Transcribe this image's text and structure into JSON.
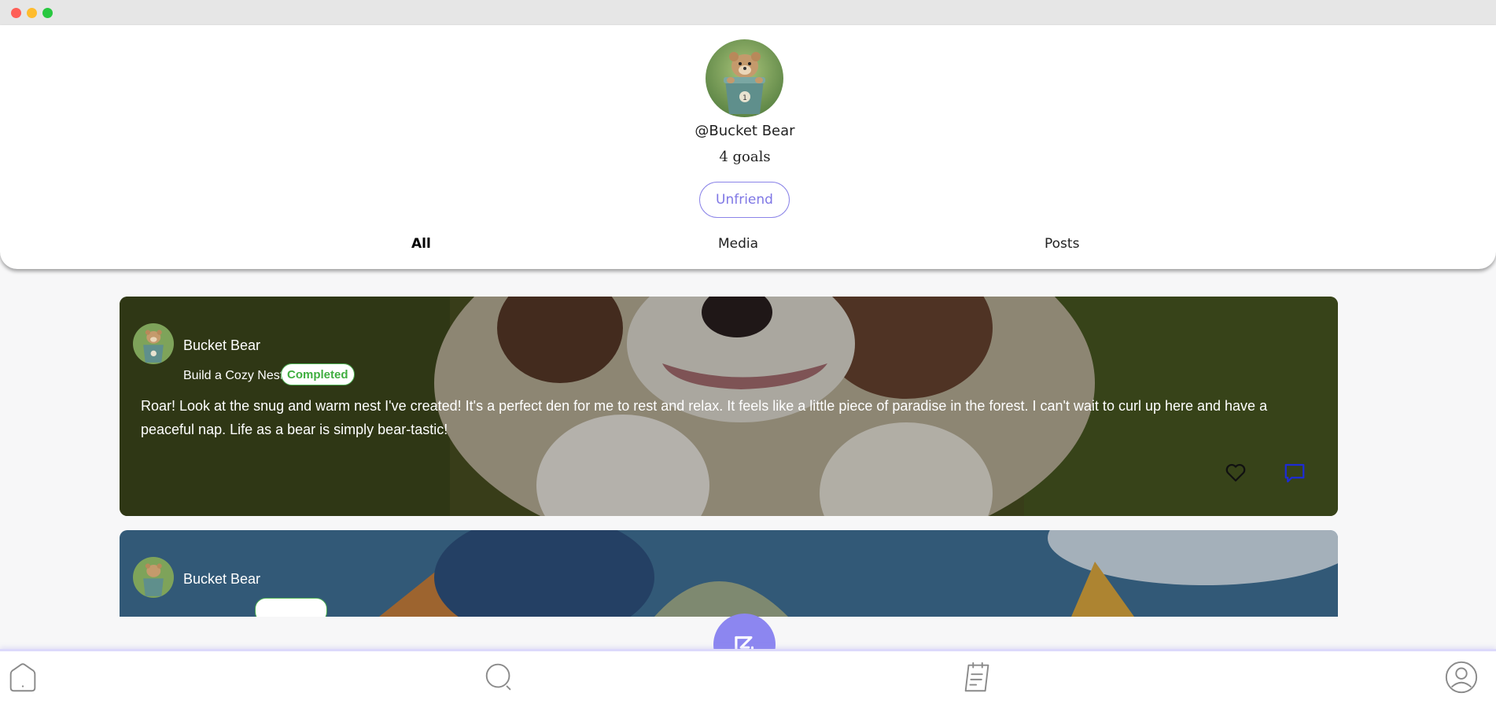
{
  "window": {
    "controls": [
      "close",
      "minimize",
      "maximize"
    ]
  },
  "profile": {
    "avatar_icon": "bear-in-bucket-avatar",
    "username": "@Bucket Bear",
    "goals": "4 goals",
    "unfriend_label": "Unfriend"
  },
  "tabs": [
    {
      "label": "All",
      "active": true
    },
    {
      "label": "Media",
      "active": false
    },
    {
      "label": "Posts",
      "active": false
    }
  ],
  "feed": [
    {
      "author": "Bucket Bear",
      "goal": "Build a Cozy Nest",
      "status": "Completed",
      "text": "Roar! Look at the snug and warm nest I've created! It's a perfect den for me to rest and relax. It feels like a little piece of paradise in the forest. I can't wait to curl up here and have a peaceful nap. Life as a bear is simply bear-tastic!",
      "like_icon": "heart-icon",
      "comment_icon": "comment-icon"
    },
    {
      "author": "Bucket Bear"
    }
  ],
  "bottom_nav": {
    "items": [
      "home-icon",
      "search-icon",
      "add-goal-icon",
      "planner-icon",
      "profile-icon"
    ]
  },
  "colors": {
    "accent": "#8c86f0",
    "completed": "#3fae3f",
    "comment_icon": "#1d2bd6"
  }
}
